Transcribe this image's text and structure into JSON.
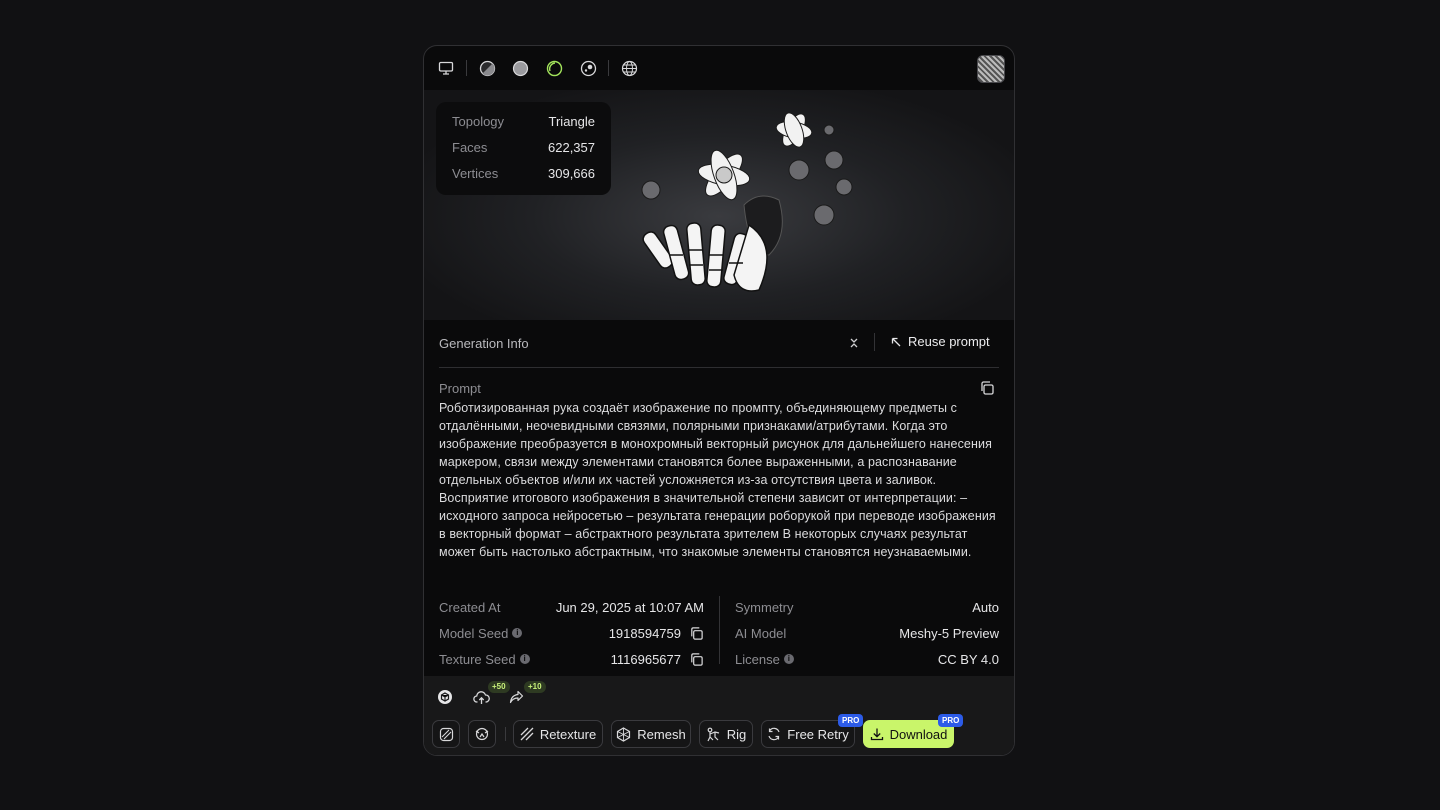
{
  "stats": {
    "rows": [
      {
        "label": "Topology",
        "value": "Triangle"
      },
      {
        "label": "Faces",
        "value": "622,357"
      },
      {
        "label": "Vertices",
        "value": "309,666"
      }
    ]
  },
  "toolbar": {
    "icons": [
      "monitor-icon",
      "half-shaded-sphere-icon",
      "solid-sphere-icon",
      "wireframe-ring-icon",
      "normal-map-icon",
      "globe-icon"
    ],
    "active_color": "#a3e45c"
  },
  "generation": {
    "title": "Generation Info",
    "reuse_label": "Reuse prompt"
  },
  "prompt": {
    "label": "Prompt",
    "text": "Роботизированная рука создаёт изображение по промпту, объединяющему предметы с отдалёнными, неочевидными связями, полярными признаками/атрибутами. Когда это изображение преобразуется в монохромный векторный рисунок для дальнейшего нанесения маркером, связи между элементами становятся более выраженными, а распознавание отдельных объектов и/или их частей усложняется из-за отсутствия цвета и заливок. Восприятие итогового изображения в значительной степени зависит от интерпретации: – исходного запроса нейросетью – результата генерации роборукой при переводе изображения в векторный формат – абстрактного результата зрителем В некоторых случаях результат может быть настолько абстрактным, что знакомые элементы становятся неузнаваемыми."
  },
  "meta_left": [
    {
      "label": "Created At",
      "value": "Jun 29, 2025 at 10:07 AM"
    },
    {
      "label": "Model Seed",
      "value": "1918594759"
    },
    {
      "label": "Texture Seed",
      "value": "1116965677"
    }
  ],
  "meta_right": [
    {
      "label": "Symmetry",
      "value": "Auto"
    },
    {
      "label": "AI Model",
      "value": "Meshy-5 Preview"
    },
    {
      "label": "License",
      "value": "CC BY 4.0"
    }
  ],
  "actions": {
    "upload_bonus": "+50",
    "share_bonus": "+10",
    "retexture": "Retexture",
    "remesh": "Remesh",
    "rig": "Rig",
    "free_retry": "Free Retry",
    "download": "Download",
    "pro_badge": "PRO"
  },
  "colors": {
    "accent": "#c9f56a",
    "pro": "#2c5be8"
  }
}
